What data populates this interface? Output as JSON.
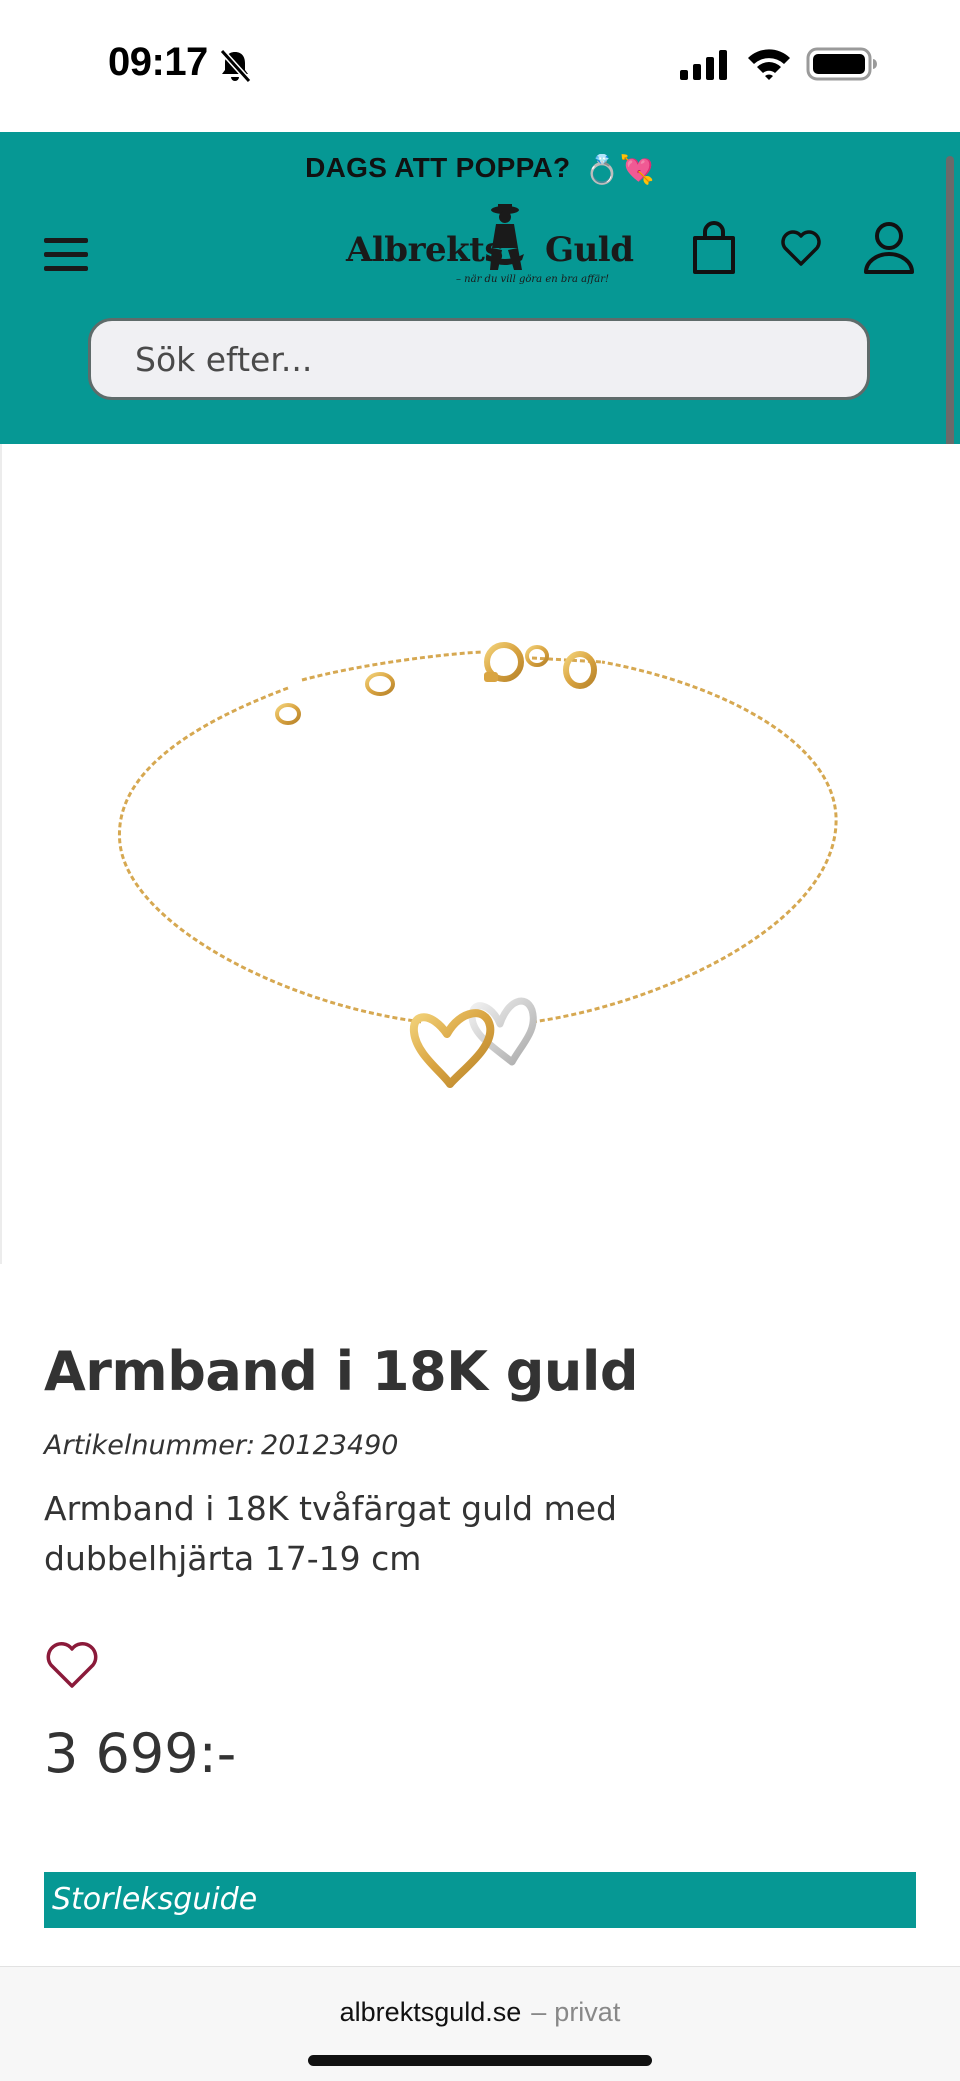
{
  "status_bar": {
    "time": "09:17",
    "icons": [
      "bell-slash-icon",
      "cellular-signal-icon",
      "wifi-icon",
      "battery-icon"
    ]
  },
  "header": {
    "promo_text": "DAGS ATT POPPA?",
    "promo_emoji": "💍💘",
    "logo": {
      "name_left": "Albrekts",
      "name_right": "Guld",
      "tagline": "– när du vill göra en bra affär!"
    },
    "search_placeholder": "Sök efter...",
    "background_color": "#069894"
  },
  "product": {
    "title": "Armband i 18K guld",
    "article_label": "Artikelnummer:",
    "article_number": "20123490",
    "description": "Armband i 18K tvåfärgat guld med dubbelhjärta 17-19 cm",
    "price": "3 699:-",
    "wishlist_heart_color": "#8b1a3a"
  },
  "size_guide": {
    "label": "Storleksguide"
  },
  "browser": {
    "domain": "albrektsguld.se",
    "separator": "–",
    "mode": "privat"
  }
}
